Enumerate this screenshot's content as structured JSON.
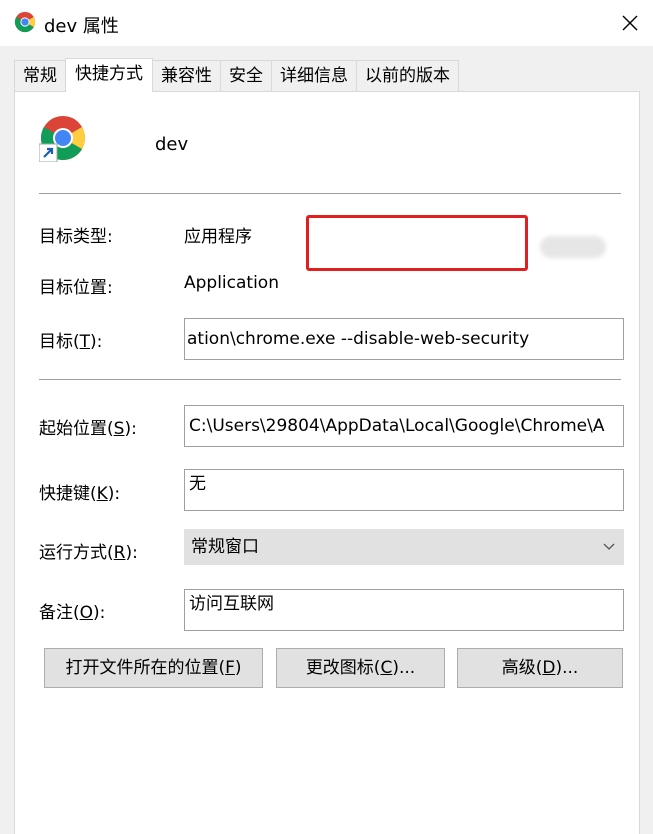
{
  "window": {
    "title": "dev 属性",
    "close_icon": "close-icon"
  },
  "tabs": [
    {
      "label": "常规",
      "active": false
    },
    {
      "label": "快捷方式",
      "active": true
    },
    {
      "label": "兼容性",
      "active": false
    },
    {
      "label": "安全",
      "active": false
    },
    {
      "label": "详细信息",
      "active": false
    },
    {
      "label": "以前的版本",
      "active": false
    }
  ],
  "shortcut": {
    "icon": "chrome-shortcut-icon",
    "name": "dev",
    "target_type_label": "目标类型:",
    "target_type_value": "应用程序",
    "target_location_label": "目标位置:",
    "target_location_value": "Application",
    "target_label_prefix": "目标(",
    "target_label_key": "T",
    "target_label_suffix": "):",
    "target_value": "ation\\chrome.exe --disable-web-security",
    "start_in_label_prefix": "起始位置(",
    "start_in_label_key": "S",
    "start_in_label_suffix": "):",
    "start_in_value": "C:\\Users\\29804\\AppData\\Local\\Google\\Chrome\\A",
    "hotkey_label_prefix": "快捷键(",
    "hotkey_label_key": "K",
    "hotkey_label_suffix": "):",
    "hotkey_value": "无",
    "run_label_prefix": "运行方式(",
    "run_label_key": "R",
    "run_label_suffix": "):",
    "run_value": "常规窗口",
    "comment_label_prefix": "备注(",
    "comment_label_key": "O",
    "comment_label_suffix": "):",
    "comment_value": "访问互联网"
  },
  "buttons": {
    "open_location_prefix": "打开文件所在的位置(",
    "open_location_key": "F",
    "open_location_suffix": ")",
    "change_icon_prefix": "更改图标(",
    "change_icon_key": "C",
    "change_icon_suffix": ")...",
    "advanced_prefix": "高级(",
    "advanced_key": "D",
    "advanced_suffix": ")..."
  },
  "colors": {
    "highlight": "#e02020",
    "button_bg": "#e1e1e1"
  }
}
